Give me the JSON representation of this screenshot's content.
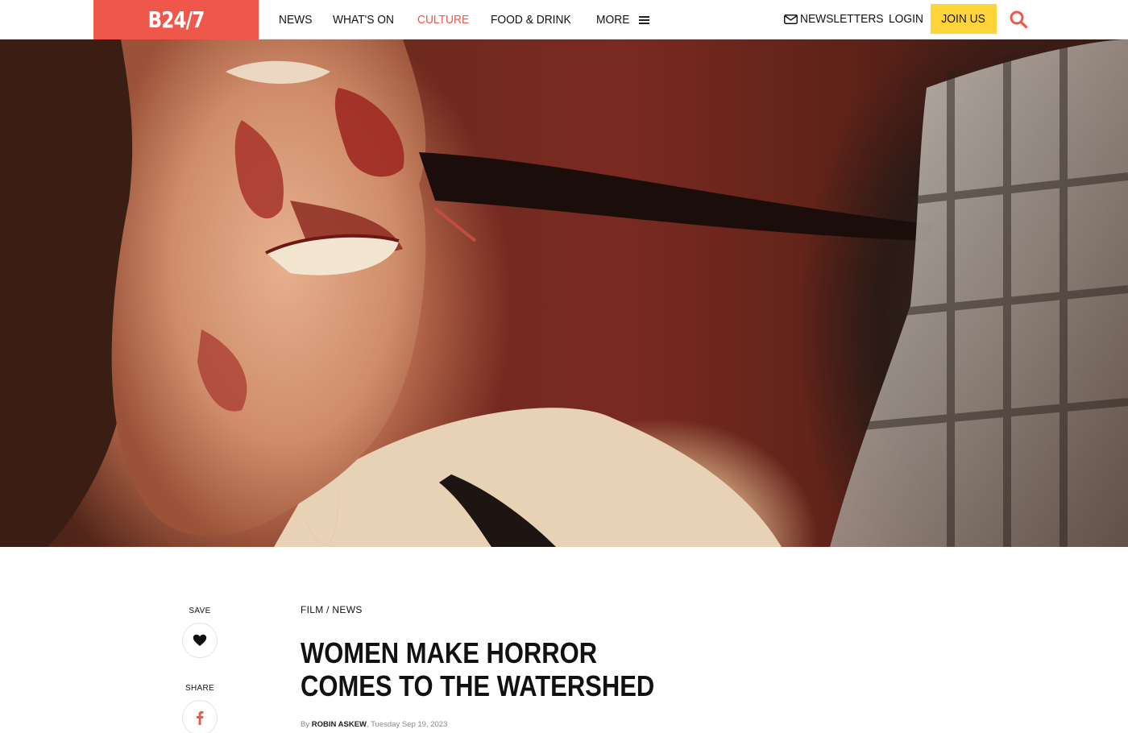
{
  "header": {
    "logo": "B24/7",
    "nav": [
      "NEWS",
      "WHAT'S ON",
      "CULTURE",
      "FOOD & DRINK",
      "MORE"
    ],
    "active_nav": "CULTURE",
    "newsletters": "NEWSLETTERS",
    "login": "LOGIN",
    "join": "JOIN US"
  },
  "hero": {
    "description_icon": "film-still-image"
  },
  "side": {
    "save_label": "SAVE",
    "share_label": "SHARE"
  },
  "article": {
    "category": "FILM / NEWS",
    "headline": "WOMEN MAKE HORROR COMES TO THE WATERSHED",
    "by": "By",
    "author": "ROBIN ASKEW",
    "date": "Tuesday Sep 19, 2023"
  },
  "colors": {
    "brand": "#f0574b",
    "join_button": "#ffd53a"
  }
}
